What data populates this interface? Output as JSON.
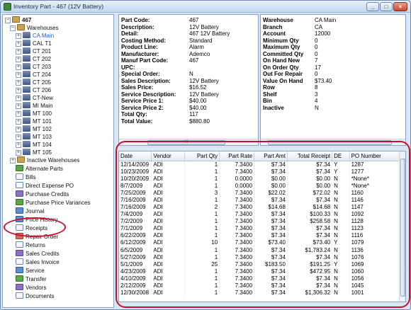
{
  "window": {
    "title": "Inventory Part - 467 (12V Battery)",
    "minimize": "_",
    "maximize": "□",
    "close": "×"
  },
  "tree": {
    "root": "467",
    "warehouses_label": "Warehouses",
    "warehouses": [
      "CA Main",
      "CAL T1",
      "CT 201",
      "CT 202",
      "CT 203",
      "CT 204",
      "CT 205",
      "CT 206",
      "CT-New",
      "MI Main",
      "MT 100",
      "MT 101",
      "MT 102",
      "MT 103",
      "MT 104",
      "MT 105"
    ],
    "items": [
      "Inactive Warehouses",
      "Alternate Parts",
      "Bills",
      "Direct Expense PO",
      "Purchase Credits",
      "Purchase Price Variances",
      "Journal",
      "Price History",
      "Receipts",
      "Repair Order",
      "Returns",
      "Sales Credits",
      "Sales Invoice",
      "Service",
      "Transfer",
      "Vendors",
      "Documents"
    ]
  },
  "details": [
    {
      "label": "Part Code:",
      "value": "467"
    },
    {
      "label": "Description:",
      "value": "12V Battery"
    },
    {
      "label": "Detail:",
      "value": "467 12V Battery"
    },
    {
      "label": "Costing Method:",
      "value": "Standard"
    },
    {
      "label": "Product Line:",
      "value": "Alarm"
    },
    {
      "label": "Manufacturer:",
      "value": "Ademco"
    },
    {
      "label": "Manuf Part Code:",
      "value": "467"
    },
    {
      "label": "UPC:",
      "value": ""
    },
    {
      "label": "Special Order:",
      "value": "N"
    },
    {
      "label": "Sales Description:",
      "value": "12V Battery"
    },
    {
      "label": "Sales Price:",
      "value": "$16.52"
    },
    {
      "label": "Service Description:",
      "value": "12V Battery"
    },
    {
      "label": "Service Price 1:",
      "value": "$40.00"
    },
    {
      "label": "Service Price 2:",
      "value": "$40.00"
    },
    {
      "label": "Total Qty:",
      "value": "117"
    },
    {
      "label": "Total Value:",
      "value": "$880.80"
    }
  ],
  "warehouse_info": [
    {
      "label": "Warehouse",
      "value": "CA Main"
    },
    {
      "label": "Branch",
      "value": "CA"
    },
    {
      "label": "Account",
      "value": "12000"
    },
    {
      "label": "Minimum Qty",
      "value": "0"
    },
    {
      "label": "Maximum Qty",
      "value": "0"
    },
    {
      "label": "Committed Qty",
      "value": "0"
    },
    {
      "label": "On Hand New",
      "value": "7"
    },
    {
      "label": "On Order Qty",
      "value": "17"
    },
    {
      "label": "Out For Repair",
      "value": "0"
    },
    {
      "label": "Value On Hand",
      "value": "$73.40"
    },
    {
      "label": "Row",
      "value": "8"
    },
    {
      "label": "Shelf",
      "value": "3"
    },
    {
      "label": "Bin",
      "value": "4"
    },
    {
      "label": "Inactive",
      "value": "N"
    }
  ],
  "scroll_marker": "III",
  "receipts": {
    "columns": [
      "Date",
      "Vendor",
      "Part Qty",
      "Part Rate",
      "Part Amt",
      "Total Receipt",
      "DE",
      "PO Number"
    ],
    "rows": [
      [
        "12/14/2009",
        "ADI",
        "1",
        "7.3400",
        "$7.34",
        "$7.34",
        "Y",
        "1287"
      ],
      [
        "10/23/2009",
        "ADI",
        "1",
        "7.3400",
        "$7.34",
        "$7.34",
        "Y",
        "1277"
      ],
      [
        "10/20/2009",
        "ADI",
        "1",
        "0.0000",
        "$0.00",
        "$0.00",
        "N",
        "*None*"
      ],
      [
        "8/7/2009",
        "ADI",
        "1",
        "0.0000",
        "$0.00",
        "$0.00",
        "N",
        "*None*"
      ],
      [
        "7/25/2009",
        "ADI",
        "3",
        "7.3400",
        "$22.02",
        "$72.02",
        "N",
        "1160"
      ],
      [
        "7/16/2009",
        "ADI",
        "1",
        "7.3400",
        "$7.34",
        "$7.34",
        "N",
        "1146"
      ],
      [
        "7/16/2009",
        "ADI",
        "2",
        "7.3400",
        "$14.68",
        "$14.68",
        "N",
        "1147"
      ],
      [
        "7/4/2009",
        "ADI",
        "1",
        "7.3400",
        "$7.34",
        "$100.33",
        "N",
        "1092"
      ],
      [
        "7/2/2009",
        "ADI",
        "1",
        "7.3400",
        "$7.34",
        "$258.58",
        "N",
        "1128"
      ],
      [
        "7/1/2009",
        "ADI",
        "1",
        "7.3400",
        "$7.34",
        "$7.34",
        "N",
        "1123"
      ],
      [
        "6/22/2009",
        "ADI",
        "1",
        "7.3400",
        "$7.34",
        "$7.34",
        "N",
        "1116"
      ],
      [
        "6/12/2009",
        "ADI",
        "10",
        "7.3400",
        "$73.40",
        "$73.40",
        "Y",
        "1079"
      ],
      [
        "6/5/2009",
        "ADI",
        "1",
        "7.3400",
        "$7.34",
        "$1,783.24",
        "N",
        "1136"
      ],
      [
        "5/27/2009",
        "ADI",
        "1",
        "7.3400",
        "$7.34",
        "$7.34",
        "N",
        "1076"
      ],
      [
        "5/1/2009",
        "ADI",
        "25",
        "7.3400",
        "$183.50",
        "$191.25",
        "Y",
        "1069"
      ],
      [
        "4/23/2009",
        "ADI",
        "1",
        "7.3400",
        "$7.34",
        "$472.95",
        "N",
        "1060"
      ],
      [
        "4/10/2009",
        "ADI",
        "1",
        "7.3400",
        "$7.34",
        "$7.34",
        "N",
        "1056"
      ],
      [
        "2/12/2009",
        "ADI",
        "1",
        "7.3400",
        "$7.34",
        "$7.34",
        "N",
        "1045"
      ],
      [
        "12/30/2008",
        "ADI",
        "1",
        "7.3400",
        "$7.34",
        "$1,306.32",
        "N",
        "1001"
      ]
    ]
  }
}
